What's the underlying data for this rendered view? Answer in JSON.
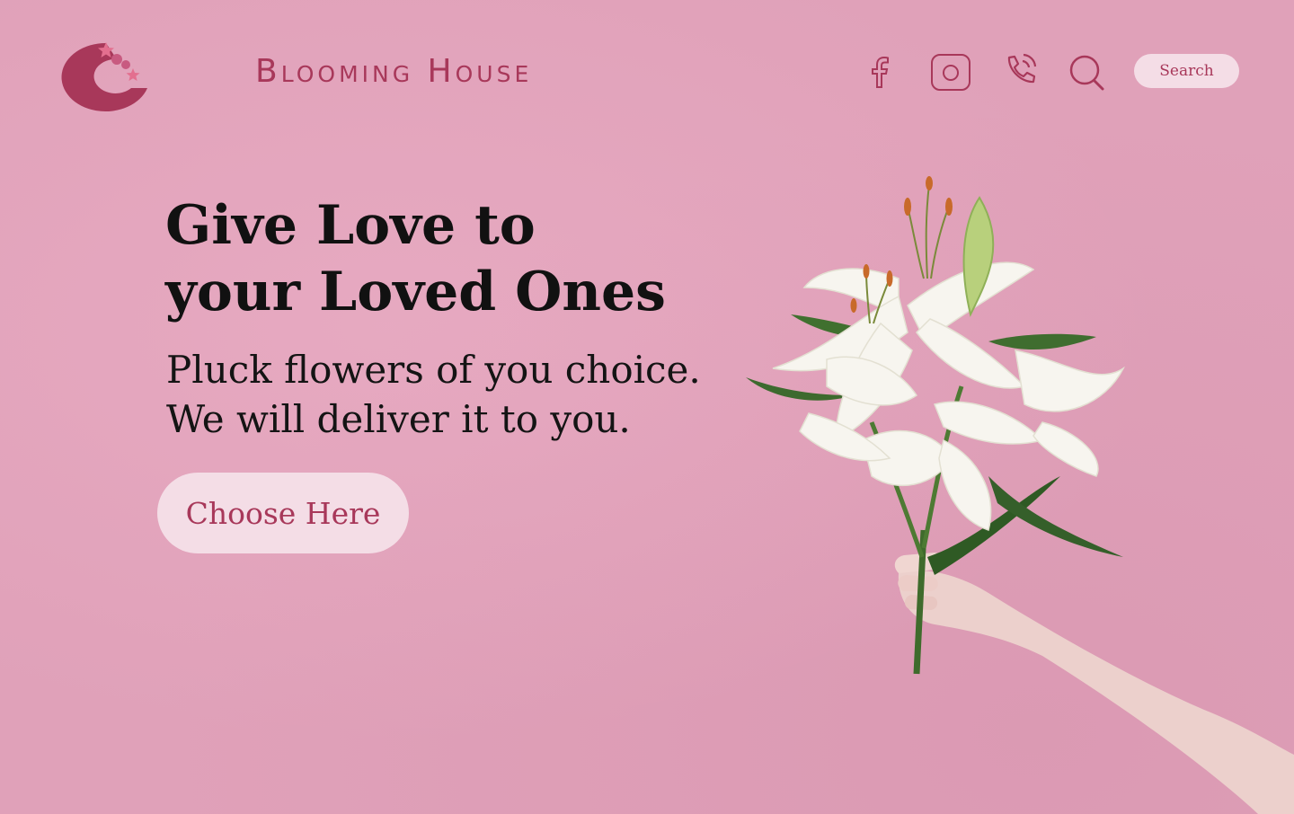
{
  "header": {
    "brand": "Blooming House",
    "search_label": "Search",
    "icons": {
      "logo": "blooming-house-logo",
      "facebook": "facebook-icon",
      "instagram": "instagram-icon",
      "phone": "phone-icon",
      "search": "search-icon"
    }
  },
  "hero": {
    "heading_lines": [
      "Give Love to",
      "your Loved Ones"
    ],
    "subheading_lines": [
      "Pluck flowers of you choice.",
      "We will deliver it to you."
    ],
    "cta_label": "Choose Here"
  },
  "colors": {
    "background": "#e0a1b9",
    "accent": "#a8385a",
    "button_bg": "#f4dde6",
    "heading": "#111111"
  }
}
